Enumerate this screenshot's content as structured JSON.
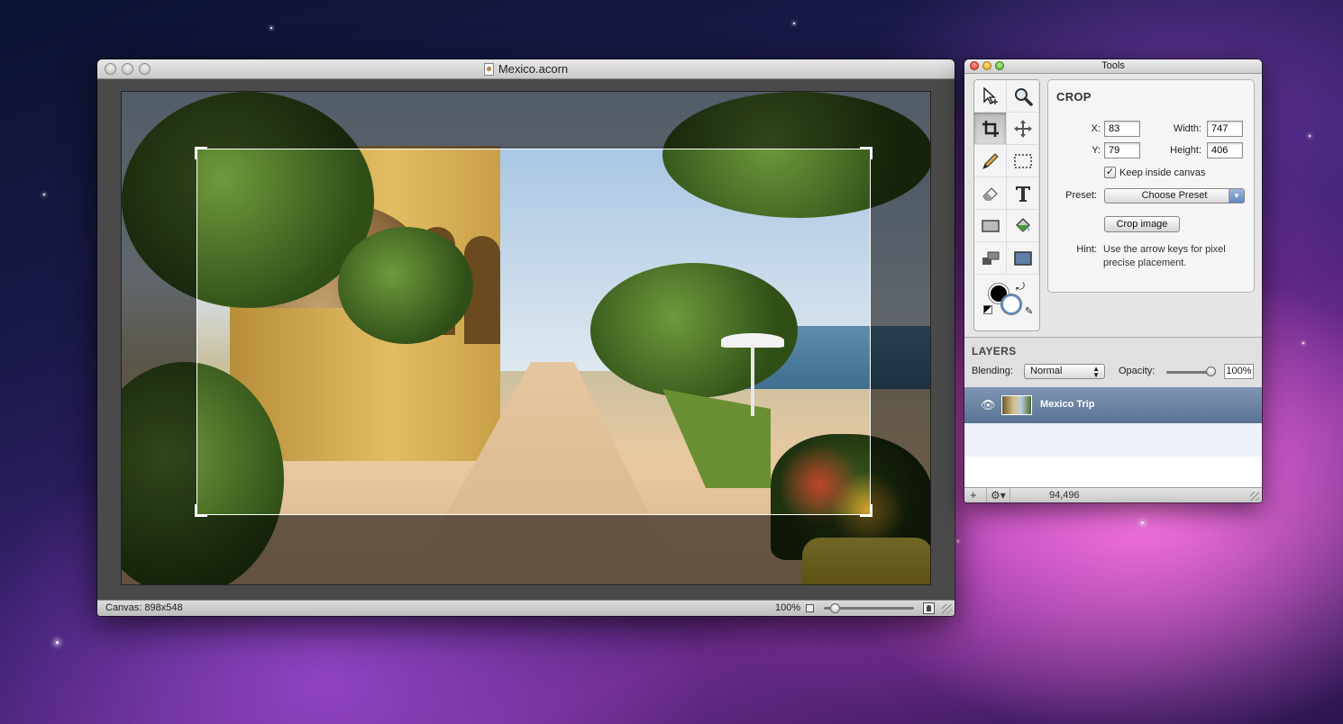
{
  "desktop": {
    "wallpaper": "galaxy"
  },
  "image_window": {
    "title": "Mexico.acorn",
    "status": {
      "canvas_size": "Canvas: 898x548",
      "zoom": "100%"
    },
    "icons": {
      "zoom_small": "picture-small-icon",
      "zoom_large": "person-icon"
    }
  },
  "tools_window": {
    "title": "Tools",
    "tools": [
      [
        "move-arrow-icon",
        "zoom-icon"
      ],
      [
        "crop-icon",
        "pan-icon"
      ],
      [
        "pencil-icon",
        "marquee-select-icon"
      ],
      [
        "eraser-icon",
        "text-icon"
      ],
      [
        "rectangle-icon",
        "paint-bucket-icon"
      ],
      [
        "clone-stamp-icon",
        "shape-icon"
      ]
    ],
    "colors": {
      "foreground": "#000000",
      "background": "#ffffff"
    },
    "crop": {
      "title": "CROP",
      "x_label": "X:",
      "x_value": "83",
      "y_label": "Y:",
      "y_value": "79",
      "width_label": "Width:",
      "width_value": "747",
      "height_label": "Height:",
      "height_value": "406",
      "keep_inside_label": "Keep inside canvas",
      "keep_inside_checked": true,
      "preset_label": "Preset:",
      "preset_value": "Choose Preset",
      "crop_button": "Crop image",
      "hint_label": "Hint:",
      "hint_text": "Use the arrow keys for pixel precise placement."
    },
    "layers": {
      "title": "LAYERS",
      "blending_label": "Blending:",
      "blending_value": "Normal",
      "opacity_label": "Opacity:",
      "opacity_value": "100%",
      "items": [
        {
          "name": "Mexico Trip",
          "visible": true,
          "selected": true
        }
      ],
      "footer_coords": "94,496"
    }
  }
}
